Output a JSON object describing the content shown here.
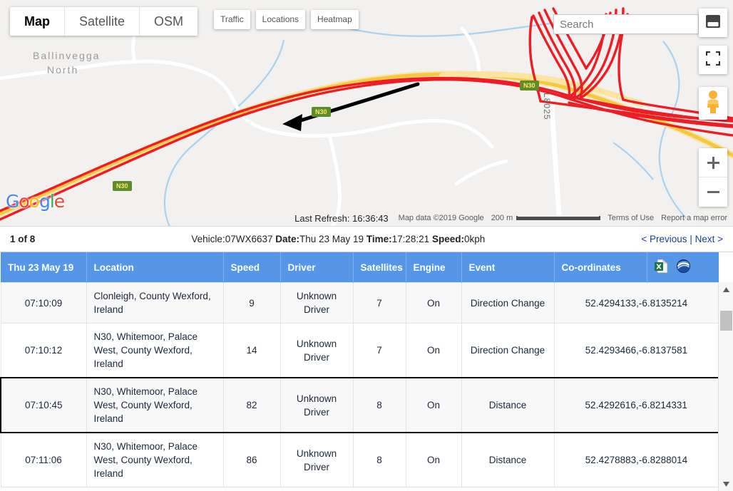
{
  "map": {
    "types": [
      {
        "label": "Map",
        "active": true
      },
      {
        "label": "Satellite",
        "active": false
      },
      {
        "label": "OSM",
        "active": false
      }
    ],
    "overlay_buttons": [
      "Traffic",
      "Locations",
      "Heatmap"
    ],
    "search_placeholder": "Search",
    "last_refresh_label": "Last Refresh: 16:36:43",
    "attribution": "Map data ©2019 Google",
    "scale_label": "200 m",
    "terms_label": "Terms of Use",
    "report_label": "Report a map error",
    "logo_letters": [
      "G",
      "o",
      "o",
      "g",
      "l",
      "e"
    ],
    "place_labels": [
      "Ballinvegga",
      "North"
    ],
    "road_labels": [
      "L8025"
    ],
    "shields": [
      "N30",
      "N30",
      "N30"
    ],
    "zoom_in": "+",
    "zoom_out": "−"
  },
  "status": {
    "page_count": "1 of 8",
    "vehicle_label": "Vehicle:",
    "vehicle_value": "07WX6637",
    "date_label": "Date:",
    "date_value": "Thu 23 May 19",
    "time_label": "Time:",
    "time_value": "17:28:21",
    "speed_label": "Speed:",
    "speed_value": "0kph",
    "previous_label": "< Previous",
    "separator": "|",
    "next_label": "Next >"
  },
  "table": {
    "columns": [
      "Thu 23 May 19",
      "Location",
      "Speed",
      "Driver",
      "Satellites",
      "Engine",
      "Event",
      "Co-ordinates",
      ""
    ],
    "export_icons": [
      "excel-export-icon",
      "google-earth-export-icon"
    ],
    "rows": [
      {
        "time": "07:10:09",
        "location": "Clonleigh, County Wexford, Ireland",
        "speed": "9",
        "driver": "Unknown Driver",
        "satellites": "7",
        "engine": "On",
        "event": "Direction Change",
        "coordinates": "52.4294133,-6.8135214",
        "selected": false
      },
      {
        "time": "07:10:12",
        "location": "N30, Whitemoor, Palace West, County Wexford, Ireland",
        "speed": "14",
        "driver": "Unknown Driver",
        "satellites": "7",
        "engine": "On",
        "event": "Direction Change",
        "coordinates": "52.4293466,-6.8137581",
        "selected": false
      },
      {
        "time": "07:10:45",
        "location": "N30, Whitemoor, Palace West, County Wexford, Ireland",
        "speed": "82",
        "driver": "Unknown Driver",
        "satellites": "8",
        "engine": "On",
        "event": "Distance",
        "coordinates": "52.4292616,-6.8214331",
        "selected": true
      },
      {
        "time": "07:11:06",
        "location": "N30, Whitemoor, Palace West, County Wexford, Ireland",
        "speed": "86",
        "driver": "Unknown Driver",
        "satellites": "8",
        "engine": "On",
        "event": "Distance",
        "coordinates": "52.4278883,-6.8288014",
        "selected": false
      }
    ]
  },
  "colors": {
    "header_blue": "#5596e6",
    "route_red": "#ee1c25",
    "route_yellow": "#f5c842",
    "shield_green": "#5f8c2a"
  }
}
